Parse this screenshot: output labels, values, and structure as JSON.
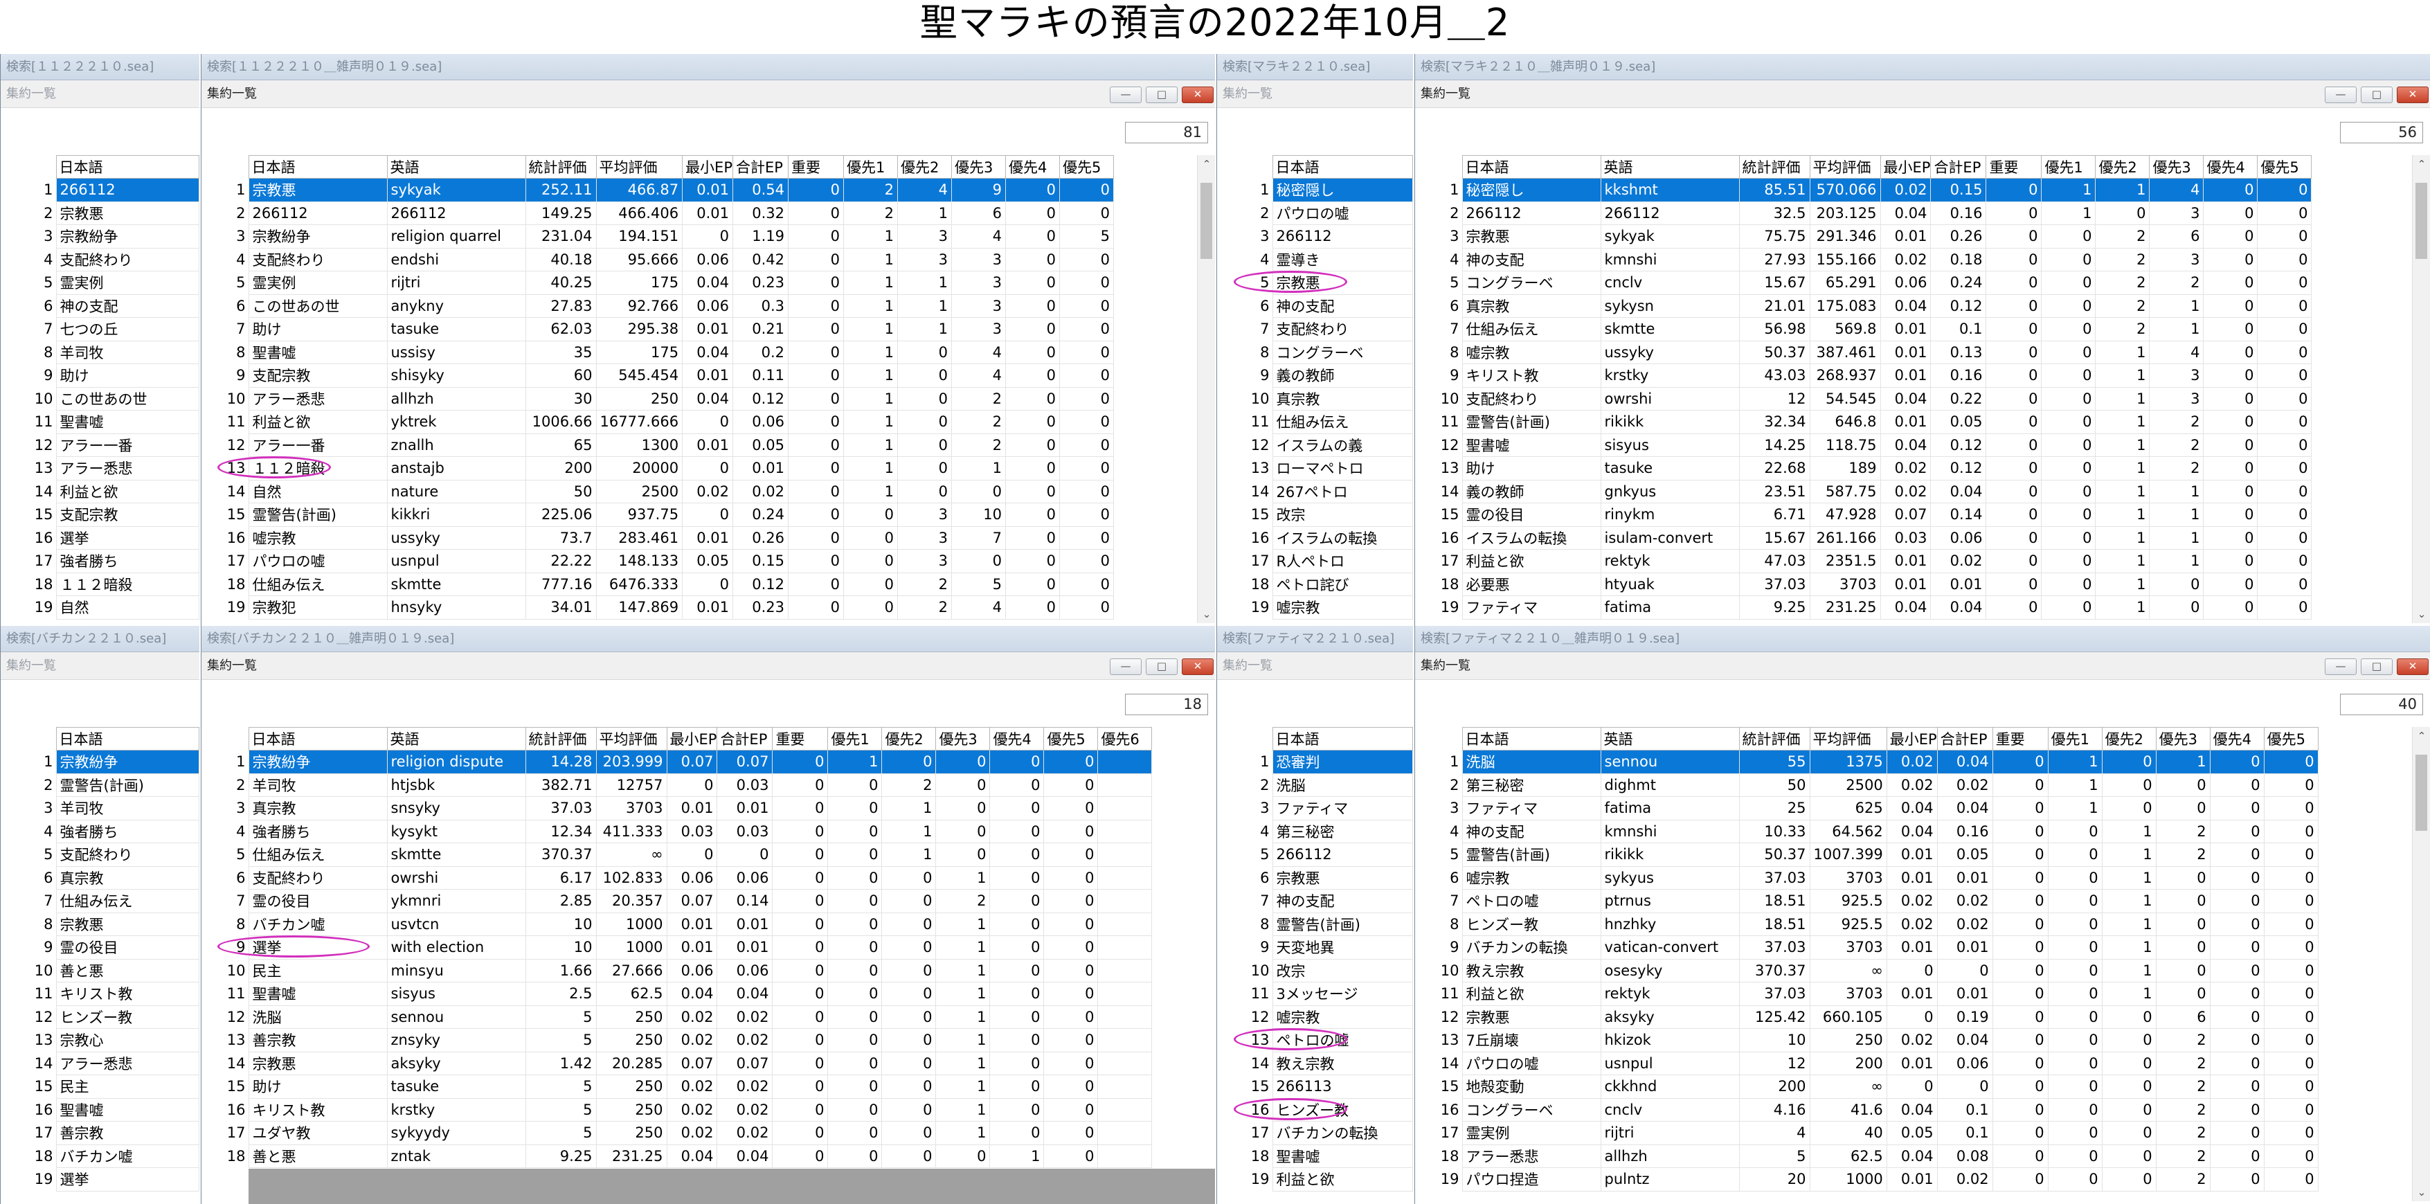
{
  "page_title": "聖マラキの預言の2022年10月＿2",
  "common": {
    "subtitle": "集約一覧",
    "btn_min": "—",
    "btn_max": "□",
    "btn_close": "✕",
    "left_header": "日本語",
    "headers": [
      "日本語",
      "英語",
      "統計評価",
      "平均評価",
      "最小EP",
      "合計EP",
      "重要",
      "優先1",
      "優先2",
      "優先3",
      "優先4",
      "優先5",
      "優先6"
    ]
  },
  "q1": {
    "left_title": "検索[１１２２２１０.sea]",
    "right_title": "検索[１１２２２１０＿雑声明０１９.sea]",
    "count": "81",
    "left_rows": [
      [
        "1",
        "266112"
      ],
      [
        "2",
        "宗教悪"
      ],
      [
        "3",
        "宗教紛争"
      ],
      [
        "4",
        "支配終わり"
      ],
      [
        "5",
        "霊実例"
      ],
      [
        "6",
        "神の支配"
      ],
      [
        "7",
        "七つの丘"
      ],
      [
        "8",
        "羊司牧"
      ],
      [
        "9",
        "助け"
      ],
      [
        "10",
        "この世あの世"
      ],
      [
        "11",
        "聖書嘘"
      ],
      [
        "12",
        "アラー一番"
      ],
      [
        "13",
        "アラー悉悲"
      ],
      [
        "14",
        "利益と欲"
      ],
      [
        "15",
        "支配宗教"
      ],
      [
        "16",
        "選挙"
      ],
      [
        "17",
        "強者勝ち"
      ],
      [
        "18",
        "１１２暗殺"
      ],
      [
        "19",
        "自然"
      ]
    ],
    "rows": [
      [
        "1",
        "宗教悪",
        "sykyak",
        "252.11",
        "466.87",
        "0.01",
        "0.54",
        "0",
        "2",
        "4",
        "9",
        "0",
        "0"
      ],
      [
        "2",
        "266112",
        "266112",
        "149.25",
        "466.406",
        "0.01",
        "0.32",
        "0",
        "2",
        "1",
        "6",
        "0",
        "0"
      ],
      [
        "3",
        "宗教紛争",
        "religion quarrel",
        "231.04",
        "194.151",
        "0",
        "1.19",
        "0",
        "1",
        "3",
        "4",
        "0",
        "5"
      ],
      [
        "4",
        "支配終わり",
        "endshi",
        "40.18",
        "95.666",
        "0.06",
        "0.42",
        "0",
        "1",
        "3",
        "3",
        "0",
        "0"
      ],
      [
        "5",
        "霊実例",
        "rijtri",
        "40.25",
        "175",
        "0.04",
        "0.23",
        "0",
        "1",
        "1",
        "3",
        "0",
        "0"
      ],
      [
        "6",
        "この世あの世",
        "anykny",
        "27.83",
        "92.766",
        "0.06",
        "0.3",
        "0",
        "1",
        "1",
        "3",
        "0",
        "0"
      ],
      [
        "7",
        "助け",
        "tasuke",
        "62.03",
        "295.38",
        "0.01",
        "0.21",
        "0",
        "1",
        "1",
        "3",
        "0",
        "0"
      ],
      [
        "8",
        "聖書嘘",
        "ussisy",
        "35",
        "175",
        "0.04",
        "0.2",
        "0",
        "1",
        "0",
        "4",
        "0",
        "0"
      ],
      [
        "9",
        "支配宗教",
        "shisyky",
        "60",
        "545.454",
        "0.01",
        "0.11",
        "0",
        "1",
        "0",
        "4",
        "0",
        "0"
      ],
      [
        "10",
        "アラー悉悲",
        "allhzh",
        "30",
        "250",
        "0.04",
        "0.12",
        "0",
        "1",
        "0",
        "2",
        "0",
        "0"
      ],
      [
        "11",
        "利益と欲",
        "yktrek",
        "1006.66",
        "16777.666",
        "0",
        "0.06",
        "0",
        "1",
        "0",
        "2",
        "0",
        "0"
      ],
      [
        "12",
        "アラー一番",
        "znallh",
        "65",
        "1300",
        "0.01",
        "0.05",
        "0",
        "1",
        "0",
        "2",
        "0",
        "0"
      ],
      [
        "13",
        "１１２暗殺",
        "anstajb",
        "200",
        "20000",
        "0",
        "0.01",
        "0",
        "1",
        "0",
        "1",
        "0",
        "0"
      ],
      [
        "14",
        "自然",
        "nature",
        "50",
        "2500",
        "0.02",
        "0.02",
        "0",
        "1",
        "0",
        "0",
        "0",
        "0"
      ],
      [
        "15",
        "霊警告(計画)",
        "kikkri",
        "225.06",
        "937.75",
        "0",
        "0.24",
        "0",
        "0",
        "3",
        "10",
        "0",
        "0"
      ],
      [
        "16",
        "嘘宗教",
        "ussyky",
        "73.7",
        "283.461",
        "0.01",
        "0.26",
        "0",
        "0",
        "3",
        "7",
        "0",
        "0"
      ],
      [
        "17",
        "パウロの嘘",
        "usnpul",
        "22.22",
        "148.133",
        "0.05",
        "0.15",
        "0",
        "0",
        "3",
        "0",
        "0",
        "0"
      ],
      [
        "18",
        "仕組み伝え",
        "skmtte",
        "777.16",
        "6476.333",
        "0",
        "0.12",
        "0",
        "0",
        "2",
        "5",
        "0",
        "0"
      ],
      [
        "19",
        "宗教犯",
        "hnsyky",
        "34.01",
        "147.869",
        "0.01",
        "0.23",
        "0",
        "0",
        "2",
        "4",
        "0",
        "0"
      ]
    ]
  },
  "q2": {
    "left_title": "検索[マラキ２２１０.sea]",
    "right_title": "検索[マラキ２２１０＿雑声明０１９.sea]",
    "count": "56",
    "left_rows": [
      [
        "1",
        "秘密隠し"
      ],
      [
        "2",
        "パウロの嘘"
      ],
      [
        "3",
        "266112"
      ],
      [
        "4",
        "霊導き"
      ],
      [
        "5",
        "宗教悪"
      ],
      [
        "6",
        "神の支配"
      ],
      [
        "7",
        "支配終わり"
      ],
      [
        "8",
        "コングラーベ"
      ],
      [
        "9",
        "義の教師"
      ],
      [
        "10",
        "真宗教"
      ],
      [
        "11",
        "仕組み伝え"
      ],
      [
        "12",
        "イスラムの義"
      ],
      [
        "13",
        "ローマペトロ"
      ],
      [
        "14",
        "267ペトロ"
      ],
      [
        "15",
        "改宗"
      ],
      [
        "16",
        "イスラムの転換"
      ],
      [
        "17",
        "R人ペトロ"
      ],
      [
        "18",
        "ペトロ詫び"
      ],
      [
        "19",
        "嘘宗教"
      ]
    ],
    "rows": [
      [
        "1",
        "秘密隠し",
        "kkshmt",
        "85.51",
        "570.066",
        "0.02",
        "0.15",
        "0",
        "1",
        "1",
        "4",
        "0",
        "0"
      ],
      [
        "2",
        "266112",
        "266112",
        "32.5",
        "203.125",
        "0.04",
        "0.16",
        "0",
        "1",
        "0",
        "3",
        "0",
        "0"
      ],
      [
        "3",
        "宗教悪",
        "sykyak",
        "75.75",
        "291.346",
        "0.01",
        "0.26",
        "0",
        "0",
        "2",
        "6",
        "0",
        "0"
      ],
      [
        "4",
        "神の支配",
        "kmnshi",
        "27.93",
        "155.166",
        "0.02",
        "0.18",
        "0",
        "0",
        "2",
        "3",
        "0",
        "0"
      ],
      [
        "5",
        "コングラーベ",
        "cnclv",
        "15.67",
        "65.291",
        "0.06",
        "0.24",
        "0",
        "0",
        "2",
        "2",
        "0",
        "0"
      ],
      [
        "6",
        "真宗教",
        "sykysn",
        "21.01",
        "175.083",
        "0.04",
        "0.12",
        "0",
        "0",
        "2",
        "1",
        "0",
        "0"
      ],
      [
        "7",
        "仕組み伝え",
        "skmtte",
        "56.98",
        "569.8",
        "0.01",
        "0.1",
        "0",
        "0",
        "2",
        "1",
        "0",
        "0"
      ],
      [
        "8",
        "嘘宗教",
        "ussyky",
        "50.37",
        "387.461",
        "0.01",
        "0.13",
        "0",
        "0",
        "1",
        "4",
        "0",
        "0"
      ],
      [
        "9",
        "キリスト教",
        "krstky",
        "43.03",
        "268.937",
        "0.01",
        "0.16",
        "0",
        "0",
        "1",
        "3",
        "0",
        "0"
      ],
      [
        "10",
        "支配終わり",
        "owrshi",
        "12",
        "54.545",
        "0.04",
        "0.22",
        "0",
        "0",
        "1",
        "3",
        "0",
        "0"
      ],
      [
        "11",
        "霊警告(計画)",
        "rikikk",
        "32.34",
        "646.8",
        "0.01",
        "0.05",
        "0",
        "0",
        "1",
        "2",
        "0",
        "0"
      ],
      [
        "12",
        "聖書嘘",
        "sisyus",
        "14.25",
        "118.75",
        "0.04",
        "0.12",
        "0",
        "0",
        "1",
        "2",
        "0",
        "0"
      ],
      [
        "13",
        "助け",
        "tasuke",
        "22.68",
        "189",
        "0.02",
        "0.12",
        "0",
        "0",
        "1",
        "2",
        "0",
        "0"
      ],
      [
        "14",
        "義の教師",
        "gnkyus",
        "23.51",
        "587.75",
        "0.02",
        "0.04",
        "0",
        "0",
        "1",
        "1",
        "0",
        "0"
      ],
      [
        "15",
        "霊の役目",
        "rinykm",
        "6.71",
        "47.928",
        "0.07",
        "0.14",
        "0",
        "0",
        "1",
        "1",
        "0",
        "0"
      ],
      [
        "16",
        "イスラムの転換",
        "isulam-convert",
        "15.67",
        "261.166",
        "0.03",
        "0.06",
        "0",
        "0",
        "1",
        "1",
        "0",
        "0"
      ],
      [
        "17",
        "利益と欲",
        "rektyk",
        "47.03",
        "2351.5",
        "0.01",
        "0.02",
        "0",
        "0",
        "1",
        "1",
        "0",
        "0"
      ],
      [
        "18",
        "必要悪",
        "htyuak",
        "37.03",
        "3703",
        "0.01",
        "0.01",
        "0",
        "0",
        "1",
        "0",
        "0",
        "0"
      ],
      [
        "19",
        "ファティマ",
        "fatima",
        "9.25",
        "231.25",
        "0.04",
        "0.04",
        "0",
        "0",
        "1",
        "0",
        "0",
        "0"
      ]
    ]
  },
  "q3": {
    "left_title": "検索[バチカン２２１０.sea]",
    "right_title": "検索[バチカン２２１０＿雑声明０１９.sea]",
    "count": "18",
    "left_rows": [
      [
        "1",
        "宗教紛争"
      ],
      [
        "2",
        "霊警告(計画)"
      ],
      [
        "3",
        "羊司牧"
      ],
      [
        "4",
        "強者勝ち"
      ],
      [
        "5",
        "支配終わり"
      ],
      [
        "6",
        "真宗教"
      ],
      [
        "7",
        "仕組み伝え"
      ],
      [
        "8",
        "宗教悪"
      ],
      [
        "9",
        "霊の役目"
      ],
      [
        "10",
        "善と悪"
      ],
      [
        "11",
        "キリスト教"
      ],
      [
        "12",
        "ヒンズー教"
      ],
      [
        "13",
        "宗教心"
      ],
      [
        "14",
        "アラー悉悲"
      ],
      [
        "15",
        "民主"
      ],
      [
        "16",
        "聖書嘘"
      ],
      [
        "17",
        "善宗教"
      ],
      [
        "18",
        "バチカン嘘"
      ],
      [
        "19",
        "選挙"
      ]
    ],
    "rows": [
      [
        "1",
        "宗教紛争",
        "religion dispute",
        "14.28",
        "203.999",
        "0.07",
        "0.07",
        "0",
        "1",
        "0",
        "0",
        "0",
        "0"
      ],
      [
        "2",
        "羊司牧",
        "htjsbk",
        "382.71",
        "12757",
        "0",
        "0.03",
        "0",
        "0",
        "2",
        "0",
        "0",
        "0"
      ],
      [
        "3",
        "真宗教",
        "snsyky",
        "37.03",
        "3703",
        "0.01",
        "0.01",
        "0",
        "0",
        "1",
        "0",
        "0",
        "0"
      ],
      [
        "4",
        "強者勝ち",
        "kysykt",
        "12.34",
        "411.333",
        "0.03",
        "0.03",
        "0",
        "0",
        "1",
        "0",
        "0",
        "0"
      ],
      [
        "5",
        "仕組み伝え",
        "skmtte",
        "370.37",
        "∞",
        "0",
        "0",
        "0",
        "0",
        "1",
        "0",
        "0",
        "0"
      ],
      [
        "6",
        "支配終わり",
        "owrshi",
        "6.17",
        "102.833",
        "0.06",
        "0.06",
        "0",
        "0",
        "0",
        "1",
        "0",
        "0"
      ],
      [
        "7",
        "霊の役目",
        "ykmnri",
        "2.85",
        "20.357",
        "0.07",
        "0.14",
        "0",
        "0",
        "0",
        "2",
        "0",
        "0"
      ],
      [
        "8",
        "バチカン嘘",
        "usvtcn",
        "10",
        "1000",
        "0.01",
        "0.01",
        "0",
        "0",
        "0",
        "1",
        "0",
        "0"
      ],
      [
        "9",
        "選挙",
        "with election",
        "10",
        "1000",
        "0.01",
        "0.01",
        "0",
        "0",
        "0",
        "1",
        "0",
        "0"
      ],
      [
        "10",
        "民主",
        "minsyu",
        "1.66",
        "27.666",
        "0.06",
        "0.06",
        "0",
        "0",
        "0",
        "1",
        "0",
        "0"
      ],
      [
        "11",
        "聖書嘘",
        "sisyus",
        "2.5",
        "62.5",
        "0.04",
        "0.04",
        "0",
        "0",
        "0",
        "1",
        "0",
        "0"
      ],
      [
        "12",
        "洗脳",
        "sennou",
        "5",
        "250",
        "0.02",
        "0.02",
        "0",
        "0",
        "0",
        "1",
        "0",
        "0"
      ],
      [
        "13",
        "善宗教",
        "znsyky",
        "5",
        "250",
        "0.02",
        "0.02",
        "0",
        "0",
        "0",
        "1",
        "0",
        "0"
      ],
      [
        "14",
        "宗教悪",
        "aksyky",
        "1.42",
        "20.285",
        "0.07",
        "0.07",
        "0",
        "0",
        "0",
        "1",
        "0",
        "0"
      ],
      [
        "15",
        "助け",
        "tasuke",
        "5",
        "250",
        "0.02",
        "0.02",
        "0",
        "0",
        "0",
        "1",
        "0",
        "0"
      ],
      [
        "16",
        "キリスト教",
        "krstky",
        "5",
        "250",
        "0.02",
        "0.02",
        "0",
        "0",
        "0",
        "1",
        "0",
        "0"
      ],
      [
        "17",
        "ユダヤ教",
        "sykyydy",
        "5",
        "250",
        "0.02",
        "0.02",
        "0",
        "0",
        "0",
        "1",
        "0",
        "0"
      ],
      [
        "18",
        "善と悪",
        "zntak",
        "9.25",
        "231.25",
        "0.04",
        "0.04",
        "0",
        "0",
        "0",
        "0",
        "1",
        "0"
      ]
    ]
  },
  "q4": {
    "left_title": "検索[ファティマ２２１０.sea]",
    "right_title": "検索[ファティマ２２１０＿雑声明０１９.sea]",
    "count": "40",
    "left_rows": [
      [
        "1",
        "恐審判"
      ],
      [
        "2",
        "洗脳"
      ],
      [
        "3",
        "ファティマ"
      ],
      [
        "4",
        "第三秘密"
      ],
      [
        "5",
        "266112"
      ],
      [
        "6",
        "宗教悪"
      ],
      [
        "7",
        "神の支配"
      ],
      [
        "8",
        "霊警告(計画)"
      ],
      [
        "9",
        "天変地異"
      ],
      [
        "10",
        "改宗"
      ],
      [
        "11",
        "3メッセージ"
      ],
      [
        "12",
        "嘘宗教"
      ],
      [
        "13",
        "ペトロの嘘"
      ],
      [
        "14",
        "教え宗教"
      ],
      [
        "15",
        "266113"
      ],
      [
        "16",
        "ヒンズー教"
      ],
      [
        "17",
        "バチカンの転換"
      ],
      [
        "18",
        "聖書嘘"
      ],
      [
        "19",
        "利益と欲"
      ]
    ],
    "rows": [
      [
        "1",
        "洗脳",
        "sennou",
        "55",
        "1375",
        "0.02",
        "0.04",
        "0",
        "1",
        "0",
        "1",
        "0",
        "0"
      ],
      [
        "2",
        "第三秘密",
        "dighmt",
        "50",
        "2500",
        "0.02",
        "0.02",
        "0",
        "1",
        "0",
        "0",
        "0",
        "0"
      ],
      [
        "3",
        "ファティマ",
        "fatima",
        "25",
        "625",
        "0.04",
        "0.04",
        "0",
        "1",
        "0",
        "0",
        "0",
        "0"
      ],
      [
        "4",
        "神の支配",
        "kmnshi",
        "10.33",
        "64.562",
        "0.04",
        "0.16",
        "0",
        "0",
        "1",
        "2",
        "0",
        "0"
      ],
      [
        "5",
        "霊警告(計画)",
        "rikikk",
        "50.37",
        "1007.399",
        "0.01",
        "0.05",
        "0",
        "0",
        "1",
        "2",
        "0",
        "0"
      ],
      [
        "6",
        "嘘宗教",
        "sykyus",
        "37.03",
        "3703",
        "0.01",
        "0.01",
        "0",
        "0",
        "1",
        "0",
        "0",
        "0"
      ],
      [
        "7",
        "ペトロの嘘",
        "ptrnus",
        "18.51",
        "925.5",
        "0.02",
        "0.02",
        "0",
        "0",
        "1",
        "0",
        "0",
        "0"
      ],
      [
        "8",
        "ヒンズー教",
        "hnzhky",
        "18.51",
        "925.5",
        "0.02",
        "0.02",
        "0",
        "0",
        "1",
        "0",
        "0",
        "0"
      ],
      [
        "9",
        "バチカンの転換",
        "vatican-convert",
        "37.03",
        "3703",
        "0.01",
        "0.01",
        "0",
        "0",
        "1",
        "0",
        "0",
        "0"
      ],
      [
        "10",
        "教え宗教",
        "osesyky",
        "370.37",
        "∞",
        "0",
        "0",
        "0",
        "0",
        "1",
        "0",
        "0",
        "0"
      ],
      [
        "11",
        "利益と欲",
        "rektyk",
        "37.03",
        "3703",
        "0.01",
        "0.01",
        "0",
        "0",
        "1",
        "0",
        "0",
        "0"
      ],
      [
        "12",
        "宗教悪",
        "aksyky",
        "125.42",
        "660.105",
        "0",
        "0.19",
        "0",
        "0",
        "0",
        "6",
        "0",
        "0"
      ],
      [
        "13",
        "7丘崩壊",
        "hkizok",
        "10",
        "250",
        "0.02",
        "0.04",
        "0",
        "0",
        "0",
        "2",
        "0",
        "0"
      ],
      [
        "14",
        "パウロの嘘",
        "usnpul",
        "12",
        "200",
        "0.01",
        "0.06",
        "0",
        "0",
        "0",
        "2",
        "0",
        "0"
      ],
      [
        "15",
        "地殻変動",
        "ckkhnd",
        "200",
        "∞",
        "0",
        "0",
        "0",
        "0",
        "0",
        "2",
        "0",
        "0"
      ],
      [
        "16",
        "コングラーベ",
        "cnclv",
        "4.16",
        "41.6",
        "0.04",
        "0.1",
        "0",
        "0",
        "0",
        "2",
        "0",
        "0"
      ],
      [
        "17",
        "霊実例",
        "rijtri",
        "4",
        "40",
        "0.05",
        "0.1",
        "0",
        "0",
        "0",
        "2",
        "0",
        "0"
      ],
      [
        "18",
        "アラー悉悲",
        "allhzh",
        "5",
        "62.5",
        "0.04",
        "0.08",
        "0",
        "0",
        "0",
        "2",
        "0",
        "0"
      ],
      [
        "19",
        "パウロ捏造",
        "pulntz",
        "20",
        "1000",
        "0.01",
        "0.02",
        "0",
        "0",
        "0",
        "2",
        "0",
        "0"
      ]
    ]
  }
}
